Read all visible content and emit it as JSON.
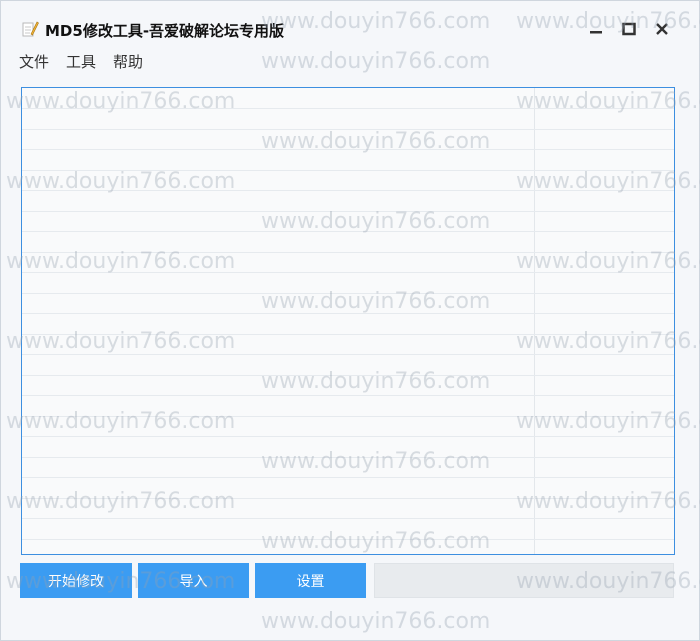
{
  "window": {
    "title": "MD5修改工具-吾爱破解论坛专用版",
    "app_icon": "notepad-icon",
    "controls": {
      "minimize_icon": "minimize-icon",
      "maximize_icon": "maximize-icon",
      "close_icon": "close-icon"
    }
  },
  "menu": {
    "items": [
      "文件",
      "工具",
      "帮助"
    ]
  },
  "buttons": {
    "start_label": "开始修改",
    "import_label": "导入",
    "settings_label": "设置"
  },
  "watermark": "www.douyin766.com",
  "colors": {
    "accent": "#3b9cf2",
    "list_border": "#3d8fe0"
  }
}
